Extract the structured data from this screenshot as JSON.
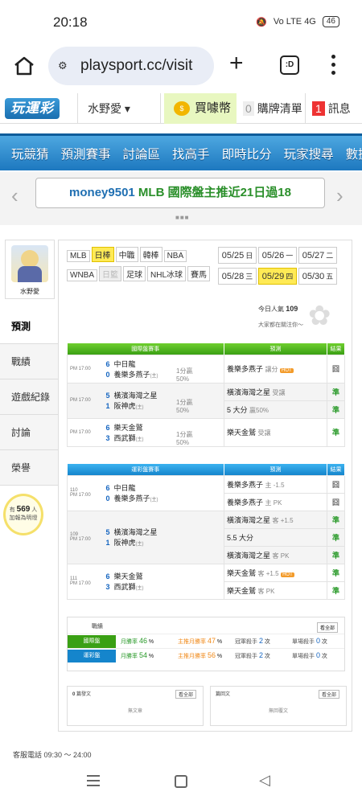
{
  "status": {
    "time": "20:18",
    "net": "Vo LTE 4G",
    "battery": "46"
  },
  "browser": {
    "url": "playsport.cc/visit",
    "tabs": ":D"
  },
  "site": {
    "logo": "玩運彩",
    "user": "水野愛 ▾",
    "buy_coin": "買噱幣",
    "cart_count": "0",
    "cart_label": "購牌清單",
    "msg_count": "1",
    "msg_label": "訊息"
  },
  "nav": [
    "玩競猜",
    "預測賽事",
    "討論區",
    "找高手",
    "即時比分",
    "玩家搜尋",
    "數據"
  ],
  "banner": {
    "user": "money9501",
    "text": "MLB 國際盤主推近21日過18"
  },
  "profile": {
    "name": "水野愛"
  },
  "sidebar": [
    "預測",
    "戰績",
    "遊戲紀錄",
    "討論",
    "榮譽"
  ],
  "viewers": {
    "pre": "有",
    "count": "569",
    "post": "人",
    "line2": "加報為明燈"
  },
  "categories": [
    {
      "label": "MLB",
      "state": ""
    },
    {
      "label": "日棒",
      "state": "sel"
    },
    {
      "label": "中職",
      "state": ""
    },
    {
      "label": "韓棒",
      "state": ""
    },
    {
      "label": "NBA",
      "state": ""
    },
    {
      "label": "WNBA",
      "state": ""
    },
    {
      "label": "日籃",
      "state": "dim"
    },
    {
      "label": "足球",
      "state": ""
    },
    {
      "label": "NHL冰球",
      "state": ""
    },
    {
      "label": "賽馬",
      "state": ""
    }
  ],
  "dates": [
    {
      "d": "05/25",
      "w": "日",
      "state": ""
    },
    {
      "d": "05/26",
      "w": "一",
      "state": ""
    },
    {
      "d": "05/27",
      "w": "二",
      "state": ""
    },
    {
      "d": "05/28",
      "w": "三",
      "state": ""
    },
    {
      "d": "05/29",
      "w": "四",
      "state": "sel"
    },
    {
      "d": "05/30",
      "w": "五",
      "state": ""
    }
  ],
  "popularity": {
    "label": "今日人氣",
    "value": "109",
    "note": "大家都在關注你～"
  },
  "intl_table": {
    "headers": [
      "國際盤賽事",
      "預測",
      "結果"
    ],
    "games": [
      {
        "time": "PM 17:00",
        "a_score": "6",
        "a_team": "中日龍",
        "b_score": "0",
        "b_team": "養樂多燕子",
        "b_tag": "(主)",
        "line1": "1分贏",
        "line2": "50%",
        "picks": [
          {
            "text": "養樂多燕子",
            "sub": "讓分",
            "hot": true,
            "res": "囧"
          }
        ]
      },
      {
        "time": "PM 17:00",
        "a_score": "5",
        "a_team": "橫濱海灣之星",
        "b_score": "1",
        "b_team": "阪神虎",
        "b_tag": "(主)",
        "line1": "1分贏",
        "line2": "50%",
        "picks": [
          {
            "text": "橫濱海灣之星",
            "sub": "受讓",
            "hot": false,
            "res": "準"
          },
          {
            "text": "5 大分",
            "sub": "贏50%",
            "hot": false,
            "res": "準"
          }
        ]
      },
      {
        "time": "PM 17:00",
        "a_score": "6",
        "a_team": "樂天金鷲",
        "b_score": "3",
        "b_team": "西武獅",
        "b_tag": "(主)",
        "line1": "1分贏",
        "line2": "50%",
        "picks": [
          {
            "text": "樂天金鷲",
            "sub": "受讓",
            "hot": false,
            "res": "準"
          }
        ]
      }
    ]
  },
  "tw_table": {
    "headers": [
      "運彩盤賽事",
      "預測",
      "結果"
    ],
    "games": [
      {
        "id": "110",
        "time": "PM 17:00",
        "a_score": "6",
        "a_team": "中日龍",
        "b_score": "0",
        "b_team": "養樂多燕子",
        "b_tag": "(主)",
        "picks": [
          {
            "text": "養樂多燕子",
            "sub": "主 -1.5",
            "hot": false,
            "res": "囧"
          },
          {
            "text": "養樂多燕子",
            "sub": "主 PK",
            "hot": false,
            "res": "囧"
          }
        ]
      },
      {
        "id": "109",
        "time": "PM 17:00",
        "a_score": "5",
        "a_team": "橫濱海灣之星",
        "b_score": "1",
        "b_team": "阪神虎",
        "b_tag": "(主)",
        "picks": [
          {
            "text": "橫濱海灣之星",
            "sub": "客 +1.5",
            "hot": false,
            "res": "準"
          },
          {
            "text": "5.5 大分",
            "sub": "",
            "hot": false,
            "res": "準"
          },
          {
            "text": "橫濱海灣之星",
            "sub": "客 PK",
            "hot": false,
            "res": "準"
          }
        ]
      },
      {
        "id": "111",
        "time": "PM 17:00",
        "a_score": "6",
        "a_team": "樂天金鷲",
        "b_score": "3",
        "b_team": "西武獅",
        "b_tag": "(主)",
        "picks": [
          {
            "text": "樂天金鷲",
            "sub": "客 +1.5",
            "hot": true,
            "res": "準"
          },
          {
            "text": "樂天金鷲",
            "sub": "客 PK",
            "hot": false,
            "res": "準"
          }
        ]
      }
    ]
  },
  "record": {
    "title": "戰績",
    "see_all": "看全部",
    "rows": [
      {
        "label": "國際盤",
        "color": "#3aa014",
        "month": "月勝率",
        "month_v": "46",
        "main": "主推月勝率",
        "main_v": "47",
        "champ": "冠軍殺手",
        "champ_v": "2",
        "single": "單場殺手",
        "single_v": "0",
        "unit1": "次",
        "unit2": "次"
      },
      {
        "label": "運彩盤",
        "color": "#1585cc",
        "month": "月勝率",
        "month_v": "54",
        "main": "主推月勝率",
        "main_v": "56",
        "champ": "冠軍殺手",
        "champ_v": "2",
        "single": "單場殺手",
        "single_v": "0",
        "unit1": "次",
        "unit2": "次"
      }
    ]
  },
  "posts": {
    "count": "0",
    "label": "篇發文",
    "see_all": "看全部",
    "empty": "無文章"
  },
  "replies": {
    "label": "篇回文",
    "see_all": "看全部",
    "empty": "無回覆文"
  },
  "footer": {
    "phone": "客服電話 09:30 ～ 24:00",
    "links": "..."
  }
}
